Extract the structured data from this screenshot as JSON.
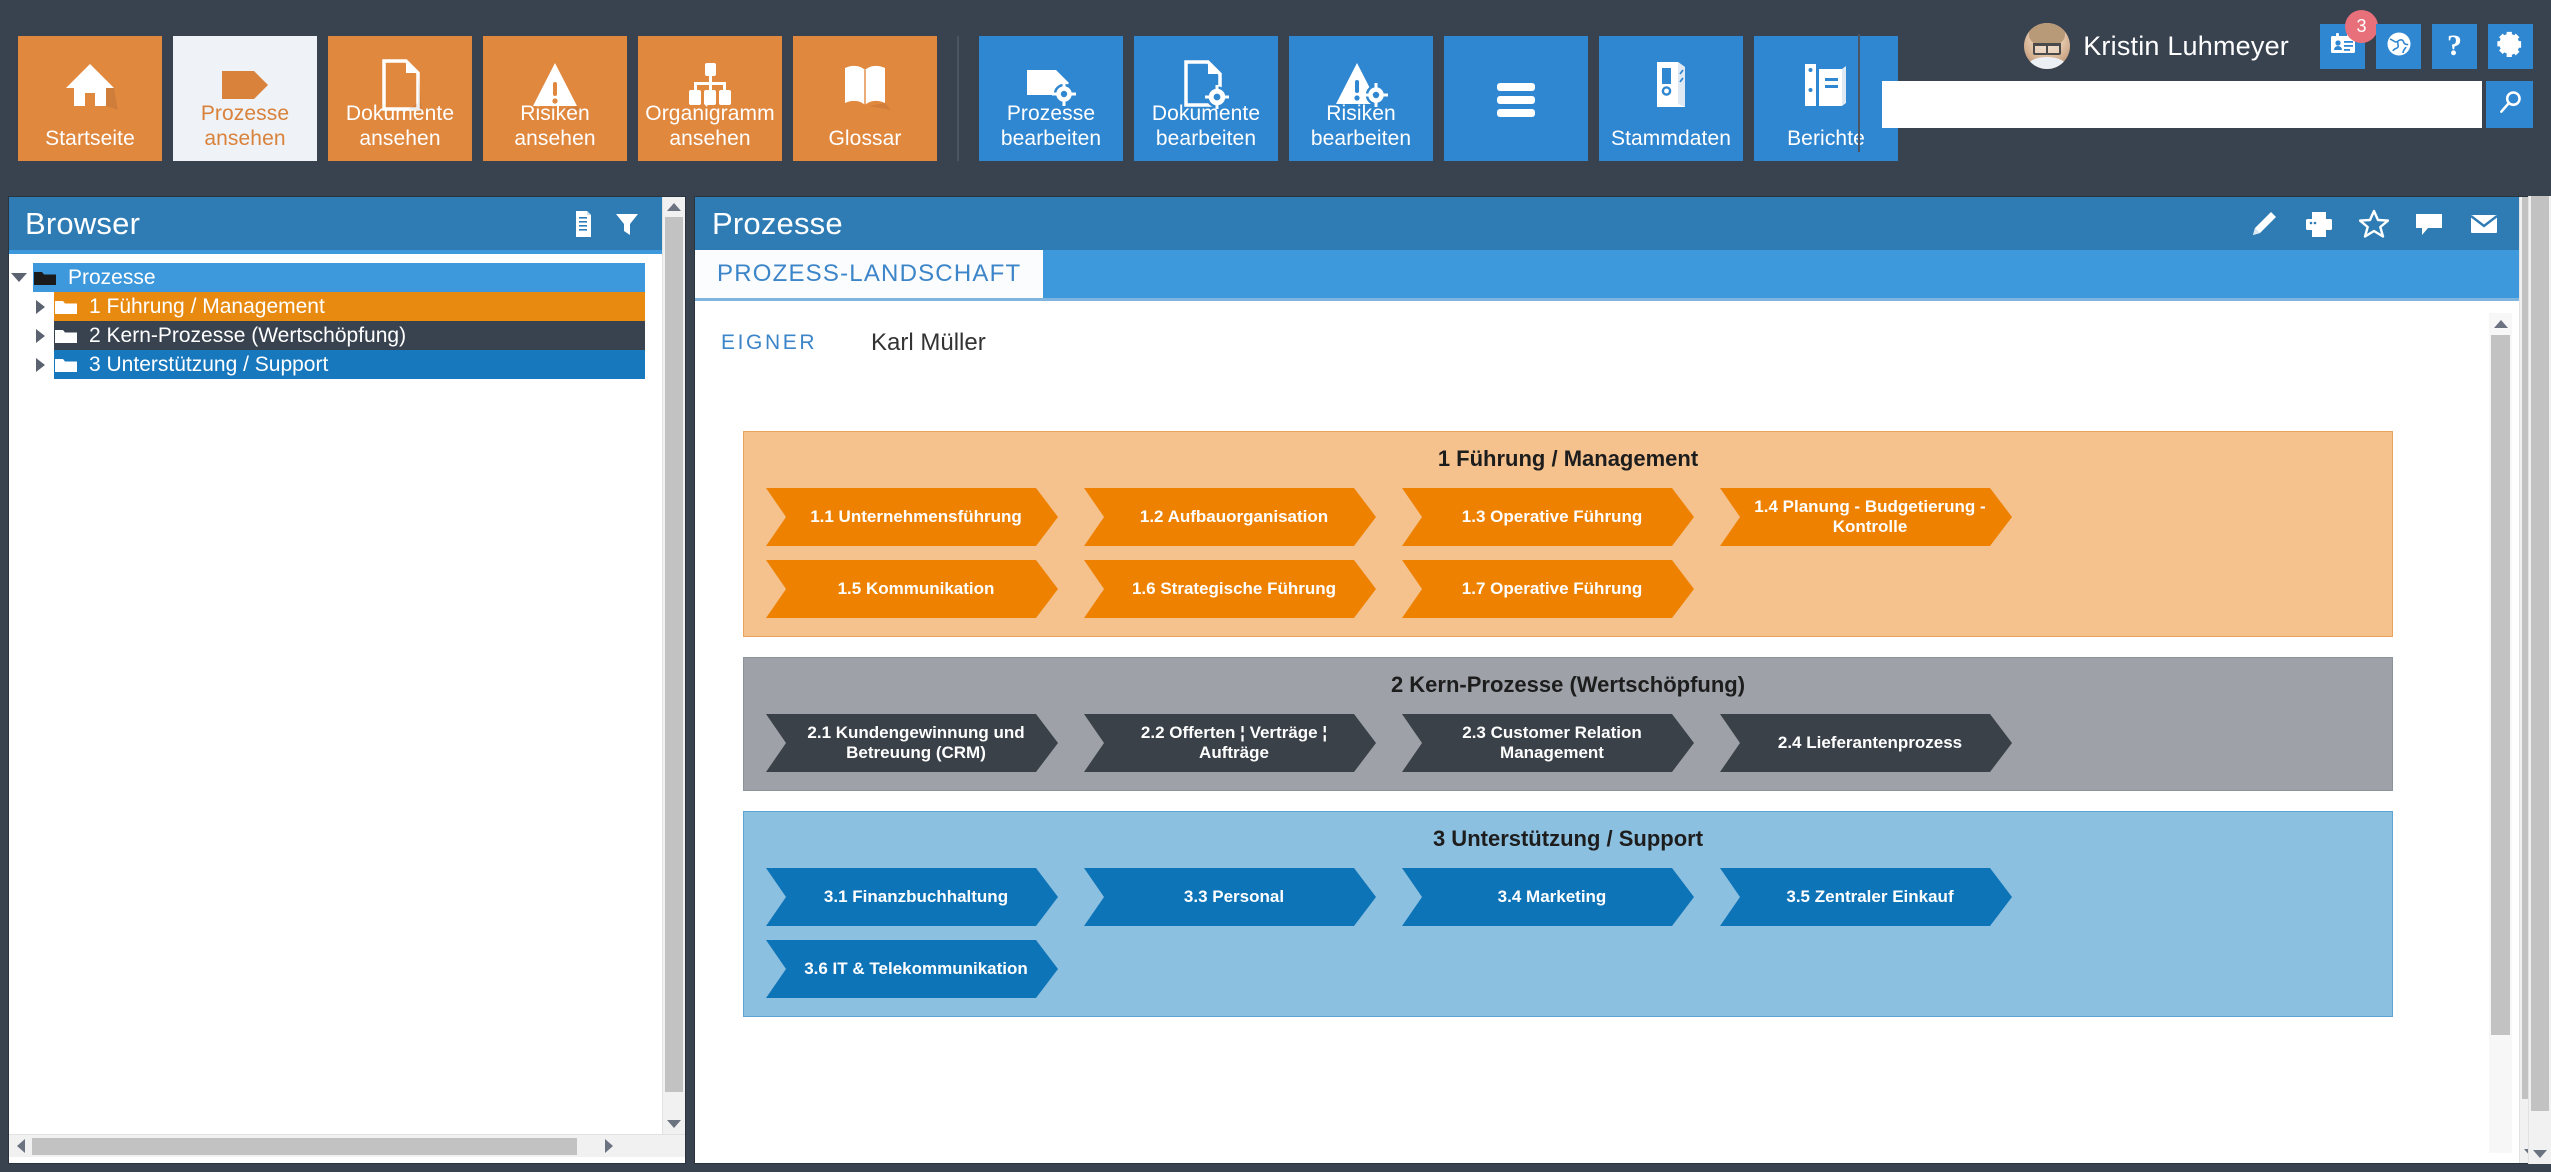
{
  "toolbar": {
    "view_tiles": [
      {
        "label": "Startseite",
        "icon": "home-icon",
        "state": "normal"
      },
      {
        "label": "Prozesse\nansehen",
        "label_l1": "Prozesse",
        "label_l2": "ansehen",
        "icon": "process-tag-icon",
        "state": "active"
      },
      {
        "label": "Dokumente ansehen",
        "label_l1": "Dokumente",
        "label_l2": "ansehen",
        "icon": "document-icon",
        "state": "normal"
      },
      {
        "label": "Risiken ansehen",
        "label_l1": "Risiken",
        "label_l2": "ansehen",
        "icon": "warning-triangle-icon",
        "state": "normal"
      },
      {
        "label": "Organigramm ansehen",
        "label_l1": "Organigramm",
        "label_l2": "ansehen",
        "icon": "org-chart-icon",
        "state": "normal"
      },
      {
        "label": "Glossar",
        "label_l1": "Glossar",
        "label_l2": "",
        "icon": "book-icon",
        "state": "normal"
      }
    ],
    "edit_tiles": [
      {
        "label": "Prozesse bearbeiten",
        "label_l1": "Prozesse",
        "label_l2": "bearbeiten",
        "icon": "process-tag-gear-icon"
      },
      {
        "label": "Dokumente bearbeiten",
        "label_l1": "Dokumente",
        "label_l2": "bearbeiten",
        "icon": "document-gear-icon"
      },
      {
        "label": "Risiken bearbeiten",
        "label_l1": "Risiken",
        "label_l2": "bearbeiten",
        "icon": "warning-gear-icon"
      },
      {
        "label": "",
        "label_l1": "",
        "label_l2": "",
        "icon": "hamburger-menu-icon"
      },
      {
        "label": "Stammdaten",
        "label_l1": "Stammdaten",
        "label_l2": "",
        "icon": "binder-icon"
      },
      {
        "label": "Berichte",
        "label_l1": "Berichte",
        "label_l2": "",
        "icon": "reports-binders-icon"
      }
    ]
  },
  "user": {
    "name": "Kristin Luhmeyer",
    "avatar_alt": "Kristin Luhmeyer",
    "actions": [
      {
        "icon": "contact-card-icon",
        "badge": "3"
      },
      {
        "icon": "globe-icon",
        "badge": ""
      },
      {
        "icon": "help-question-icon",
        "badge": ""
      },
      {
        "icon": "gear-settings-icon",
        "badge": ""
      }
    ]
  },
  "search": {
    "value": "",
    "placeholder": "",
    "button_icon": "search-magnifier-icon"
  },
  "browser": {
    "title": "Browser",
    "header_icons": [
      {
        "icon": "document-list-icon"
      },
      {
        "icon": "filter-funnel-icon"
      }
    ],
    "tree": [
      {
        "label": "Prozesse",
        "level": 0,
        "expanded": true,
        "style": "root",
        "folder_color": "#1b1b1b"
      },
      {
        "label": "1 Führung / Management",
        "level": 1,
        "expanded": false,
        "style": "orange",
        "folder_color": "#ffffff"
      },
      {
        "label": "2 Kern-Prozesse (Wertschöpfung)",
        "level": 1,
        "expanded": false,
        "style": "dark",
        "folder_color": "#ffffff"
      },
      {
        "label": "3 Unterstützung / Support",
        "level": 1,
        "expanded": false,
        "style": "blue",
        "folder_color": "#ffffff"
      }
    ]
  },
  "main": {
    "title": "Prozesse",
    "header_icons": [
      {
        "icon": "pencil-edit-icon"
      },
      {
        "icon": "printer-icon"
      },
      {
        "icon": "star-favorite-icon"
      },
      {
        "icon": "comment-bubble-icon"
      },
      {
        "icon": "envelope-mail-icon"
      }
    ],
    "tabs": [
      {
        "label": "PROZESS-LANDSCHAFT",
        "active": true
      }
    ],
    "owner_label": "EIGNER",
    "owner_value": "Karl Müller"
  },
  "diagram": {
    "groups": [
      {
        "title": "1 Führung / Management",
        "color_band": "#F5C28E",
        "chevron_color": "#EE8200",
        "rows": [
          [
            {
              "label": "1.1 Unternehmensführung"
            },
            {
              "label": "1.2 Aufbauorganisation"
            },
            {
              "label": "1.3 Operative Führung"
            },
            {
              "label": "1.4 Planung - Budgetierung - Kontrolle"
            }
          ],
          [
            {
              "label": "1.5 Kommunikation"
            },
            {
              "label": "1.6 Strategische Führung"
            },
            {
              "label": "1.7 Operative Führung"
            }
          ]
        ]
      },
      {
        "title": "2 Kern-Prozesse (Wertschöpfung)",
        "color_band": "#9EA2A8",
        "chevron_color": "#3A4149",
        "rows": [
          [
            {
              "label": "2.1 Kundengewinnung und Betreuung (CRM)"
            },
            {
              "label": "2.2 Offerten ¦ Verträge ¦ Aufträge"
            },
            {
              "label": "2.3 Customer Relation Management"
            },
            {
              "label": "2.4 Lieferantenprozess"
            }
          ]
        ]
      },
      {
        "title": "3 Unterstützung / Support",
        "color_band": "#8CC0E0",
        "chevron_color": "#0E74B8",
        "rows": [
          [
            {
              "label": "3.1 Finanzbuchhaltung"
            },
            {
              "label": "3.3 Personal"
            },
            {
              "label": "3.4 Marketing"
            },
            {
              "label": "3.5 Zentraler Einkauf"
            }
          ],
          [
            {
              "label": "3.6 IT & Telekommunikation"
            }
          ]
        ]
      }
    ]
  },
  "colors": {
    "chrome": "#394350",
    "orange": "#E1883F",
    "orange_active_bg": "#EFF2F6",
    "orange_active_text": "#D9823C",
    "blue": "#3087D1",
    "panel_header": "#2F7CB5",
    "tab_active_bg": "#FAFCFE",
    "tab_active_text": "#3C85C8",
    "badge_red": "#E8707A",
    "tree_orange": "#E88A10",
    "tree_dark": "#394350",
    "tree_blue": "#1878BE"
  }
}
